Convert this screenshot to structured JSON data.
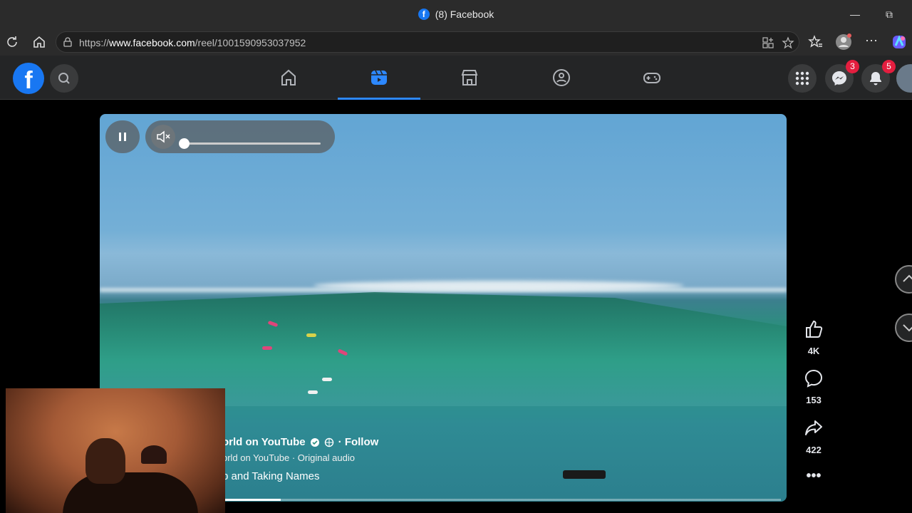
{
  "browser": {
    "tab_title": "(8) Facebook",
    "url_prefix": "https://",
    "url_host": "www.facebook.com",
    "url_path": "/reel/1001590953037952"
  },
  "fbnav": {
    "messenger_badge": "3",
    "notifications_badge": "5",
    "active_tab": "reels"
  },
  "reel": {
    "page_name": "orld on YouTube",
    "follow_label": "· Follow",
    "audio_line": "orld on YouTube · Original audio",
    "caption": "p and Taking Names",
    "progress": 0.1,
    "volume": 0
  },
  "actions": {
    "likes": "4K",
    "comments": "153",
    "shares": "422"
  },
  "colors": {
    "accent": "#1877f2",
    "active_tab": "#2d88ff",
    "badge": "#e41e3f"
  }
}
